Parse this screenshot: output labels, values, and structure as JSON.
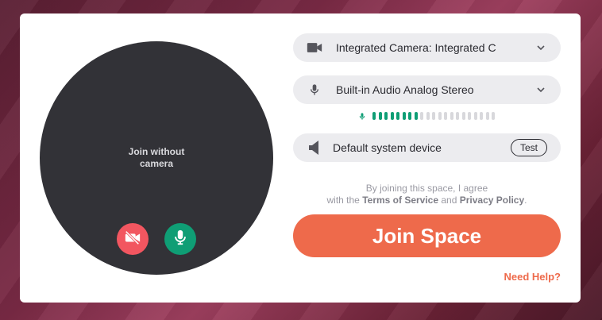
{
  "preview": {
    "no_camera_text": "Join without camera"
  },
  "devices": {
    "camera": {
      "label": "Integrated Camera: Integrated C",
      "icon": "video-camera-icon"
    },
    "microphone": {
      "label": "Built-in Audio Analog Stereo",
      "icon": "microphone-icon"
    },
    "speaker": {
      "label": "Default system device",
      "icon": "speaker-icon",
      "test_label": "Test"
    }
  },
  "mic_level": {
    "active_bars": 8,
    "total_bars": 21,
    "active_color": "#0f9e75",
    "inactive_color": "#d8d8dc"
  },
  "terms": {
    "line1": "By joining this space, I agree",
    "prefix": "with the",
    "tos": "Terms of Service",
    "and": "and",
    "privacy": "Privacy Policy",
    "period": "."
  },
  "join_label": "Join Space",
  "help_label": "Need Help?",
  "colors": {
    "accent": "#ee6a4b",
    "mic_on": "#0f9e75",
    "cam_off": "#f25660"
  }
}
